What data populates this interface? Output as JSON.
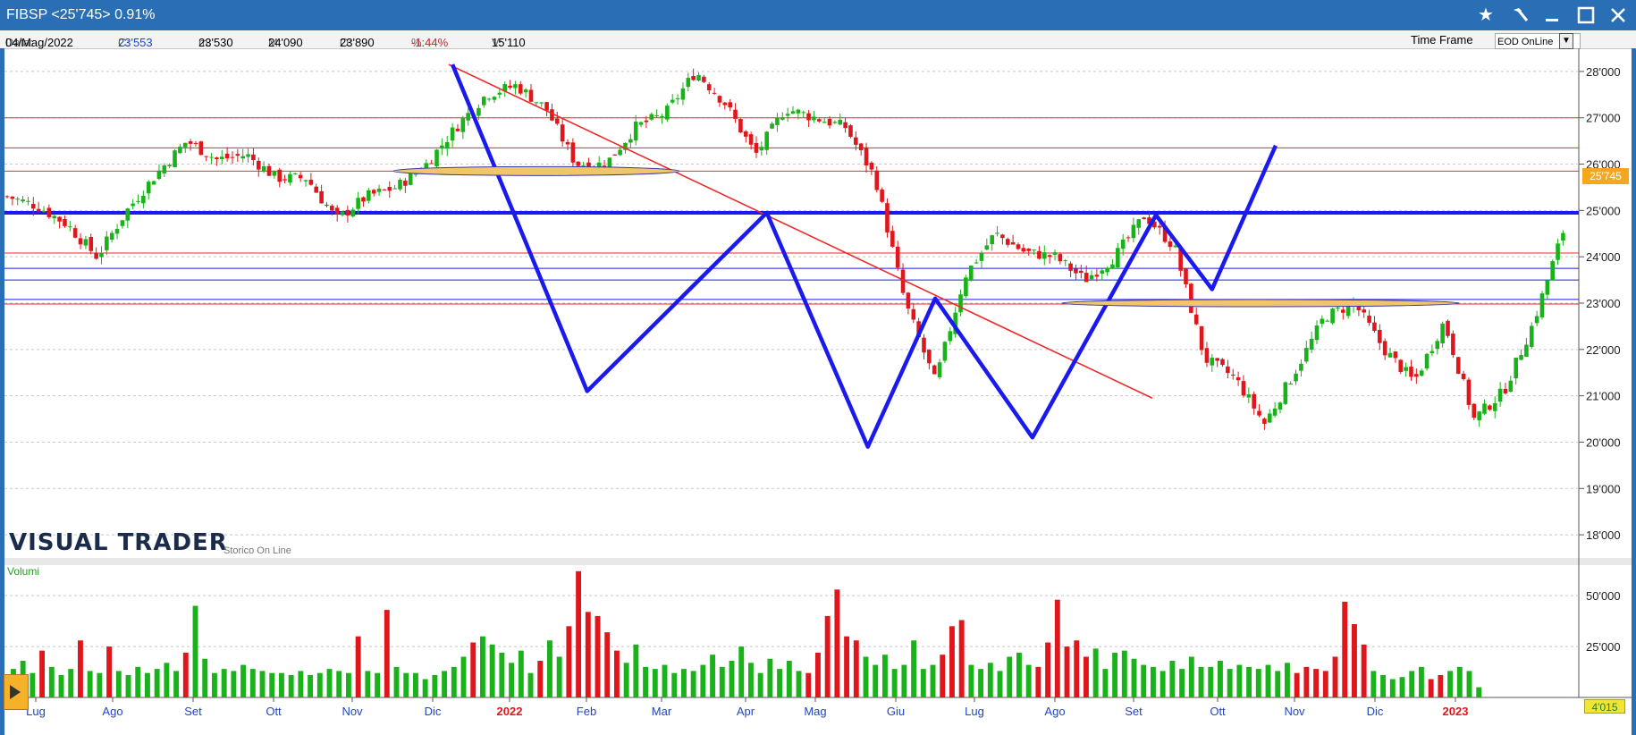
{
  "window": {
    "title": "FIBSP  <25'745>  0.91%"
  },
  "infobar": {
    "date_label": "Data:",
    "date_value": "04/Mag/2022",
    "close_label": "C:",
    "close_value": "23'553",
    "min_label": "m:",
    "min_value": "23'530",
    "max_label": "M:",
    "max_value": "24'090",
    "open_label": "O:",
    "open_value": "23'890",
    "pct_label": "%:",
    "pct_value": "-1.44%",
    "vol_label": "V:",
    "vol_value": "15'110",
    "timeframe_label": "Time Frame",
    "timeframe_value": "EOD OnLine"
  },
  "icons": {
    "favorite": "star-icon",
    "tools": "hammer-icon",
    "minimize": "minimize-icon",
    "maximize": "maximize-icon",
    "close": "close-icon"
  },
  "logo": {
    "name": "VISUAL TRADER",
    "subtitle": "Storico On Line"
  },
  "badges": {
    "last_price": "25'745",
    "last_volume": "4'015"
  },
  "colors": {
    "up": "#1ab21a",
    "down": "#e0161c",
    "pattern": "#1a1aee",
    "trend": "#ee2a2a",
    "title_bar": "#2a6fb5"
  },
  "chart_data": [
    {
      "type": "line",
      "title": "FIBSP",
      "x_axis": {
        "ticks": [
          "Lug",
          "Ago",
          "Set",
          "Ott",
          "Nov",
          "Dic",
          "2022",
          "Feb",
          "Mar",
          "Apr",
          "Mag",
          "Giu",
          "Lug",
          "Ago",
          "Set",
          "Ott",
          "Nov",
          "Dic",
          "2023"
        ]
      },
      "y_axis": {
        "range": [
          17500,
          28500
        ],
        "ticks": [
          "18'000",
          "19'000",
          "20'000",
          "21'000",
          "22'000",
          "23'000",
          "24'000",
          "25'000",
          "26'000",
          "27'000",
          "28'000"
        ],
        "tick_values": [
          18000,
          19000,
          20000,
          21000,
          22000,
          23000,
          24000,
          25000,
          26000,
          27000,
          28000
        ]
      },
      "grid": true,
      "series": [
        {
          "style": "candlestick",
          "x": [
            0,
            8,
            16,
            24,
            32,
            40,
            48,
            56,
            64,
            72,
            80,
            88,
            96,
            104,
            112,
            120,
            128,
            136,
            144,
            152,
            160,
            168,
            176,
            184,
            192,
            200,
            208,
            216,
            224,
            232,
            240,
            248,
            256,
            264,
            272,
            280,
            288,
            296,
            304,
            312,
            320,
            328,
            336,
            344,
            352,
            360,
            368,
            376,
            384,
            392,
            400,
            408,
            416
          ],
          "close": [
            25300,
            25100,
            24700,
            24000,
            25000,
            25800,
            26500,
            26100,
            26200,
            25700,
            25700,
            24800,
            25300,
            25500,
            26000,
            26800,
            27500,
            27700,
            27200,
            26000,
            26000,
            26800,
            27100,
            28000,
            27300,
            26200,
            27200,
            27000,
            26800,
            25700,
            23000,
            21300,
            23600,
            24500,
            24100,
            24000,
            23500,
            24000,
            24900,
            24200,
            21800,
            21400,
            20400,
            21500,
            22700,
            23000,
            22000,
            21300,
            22600,
            20500,
            21100,
            22600,
            24600
          ]
        }
      ],
      "pattern_points": [
        {
          "x": 119,
          "y": 28150
        },
        {
          "x": 155,
          "y": 21100
        },
        {
          "x": 203,
          "y": 24950
        },
        {
          "x": 230,
          "y": 19900
        },
        {
          "x": 248,
          "y": 23100
        },
        {
          "x": 274,
          "y": 20100
        },
        {
          "x": 307,
          "y": 24900
        },
        {
          "x": 322,
          "y": 23300
        },
        {
          "x": 339,
          "y": 26400
        }
      ],
      "trendline": [
        {
          "x": 118,
          "y": 28150
        },
        {
          "x": 306,
          "y": 20950
        }
      ],
      "hlines_blue": [
        24950,
        23750,
        23500,
        23080
      ],
      "hlines_red": [
        27000,
        26350,
        25850,
        24080,
        22980
      ]
    },
    {
      "type": "bar",
      "title": "Volumi",
      "y_axis": {
        "range": [
          0,
          65000
        ],
        "ticks": [
          "25'000",
          "50'000"
        ],
        "tick_values": [
          25000,
          50000
        ]
      },
      "values": [
        14000,
        18000,
        12000,
        23000,
        15000,
        11000,
        14000,
        28000,
        13000,
        12000,
        25000,
        13000,
        11000,
        15000,
        12000,
        14000,
        17000,
        13000,
        22000,
        45000,
        19000,
        12000,
        14000,
        13000,
        16000,
        14000,
        13000,
        12000,
        12000,
        11000,
        13000,
        11000,
        12000,
        14000,
        13000,
        12000,
        30000,
        13000,
        12000,
        43000,
        15000,
        12000,
        12000,
        9000,
        11000,
        13000,
        15000,
        20000,
        27000,
        30000,
        26000,
        22000,
        17000,
        23000,
        12000,
        18000,
        28000,
        20000,
        35000,
        62000,
        42000,
        40000,
        32000,
        23000,
        17000,
        26000,
        15000,
        14000,
        16000,
        12000,
        14000,
        13000,
        16000,
        21000,
        15000,
        18000,
        25000,
        17000,
        12000,
        19000,
        14000,
        18000,
        13000,
        12000,
        22000,
        40000,
        53000,
        30000,
        28000,
        20000,
        16000,
        21000,
        14000,
        16000,
        28000,
        14000,
        16000,
        21000,
        35000,
        38000,
        16000,
        14000,
        17000,
        13000,
        20000,
        22000,
        16000,
        15000,
        27000,
        48000,
        25000,
        28000,
        20000,
        24000,
        14000,
        22000,
        23000,
        19000,
        16000,
        15000,
        13000,
        18000,
        14000,
        20000,
        15000,
        15000,
        18000,
        14000,
        16000,
        15000,
        14000,
        16000,
        13000,
        17000,
        12000,
        15000,
        14000,
        13000,
        20000,
        47000,
        36000,
        26000,
        13000,
        11000,
        9000,
        10000,
        13000,
        15000,
        9000,
        11000,
        13000,
        15000,
        13000,
        5000
      ],
      "down_bars": [
        3,
        7,
        10,
        18,
        36,
        39,
        48,
        55,
        58,
        59,
        60,
        61,
        62,
        63,
        83,
        84,
        85,
        86,
        87,
        88,
        97,
        98,
        99,
        107,
        108,
        109,
        110,
        111,
        112,
        134,
        135,
        136,
        137,
        138,
        139,
        140,
        141,
        148,
        149
      ]
    }
  ]
}
